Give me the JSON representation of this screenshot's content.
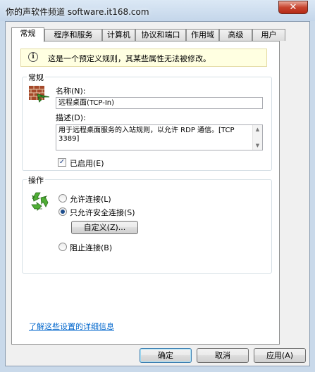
{
  "window": {
    "title": "你的声软件频道 software.it168.com",
    "close_glyph": "✕"
  },
  "tabs": [
    {
      "label": "常规"
    },
    {
      "label": "程序和服务"
    },
    {
      "label": "计算机"
    },
    {
      "label": "协议和端口"
    },
    {
      "label": "作用域"
    },
    {
      "label": "高级"
    },
    {
      "label": "用户"
    }
  ],
  "notice": {
    "icon": "info-icon",
    "icon_glyph": "i",
    "text": "这是一个预定义规则，其某些属性无法被修改。"
  },
  "general": {
    "group_title": "常规",
    "icon": "firewall-rule-icon",
    "name_label": "名称(N):",
    "name_value": "远程桌面(TCP-In)",
    "desc_label": "描述(D):",
    "desc_value": "用于远程桌面服务的入站规则，以允许 RDP 通信。[TCP 3389]",
    "enabled_label": "已启用(E)",
    "enabled_checked": true,
    "check_glyph": "✓"
  },
  "action": {
    "group_title": "操作",
    "icon": "recycle-arrows-icon",
    "options": [
      {
        "label": "允许连接(L)",
        "checked": false
      },
      {
        "label": "只允许安全连接(S)",
        "checked": true
      },
      {
        "label": "阻止连接(B)",
        "checked": false
      }
    ],
    "customize_label": "自定义(Z)..."
  },
  "link_text": "了解这些设置的详细信息",
  "buttons": {
    "ok": "确定",
    "cancel": "取消",
    "apply": "应用(A)"
  },
  "colors": {
    "link": "#0066cc",
    "notice_bg": "#ffffe1",
    "close_button": "#c7452f"
  }
}
